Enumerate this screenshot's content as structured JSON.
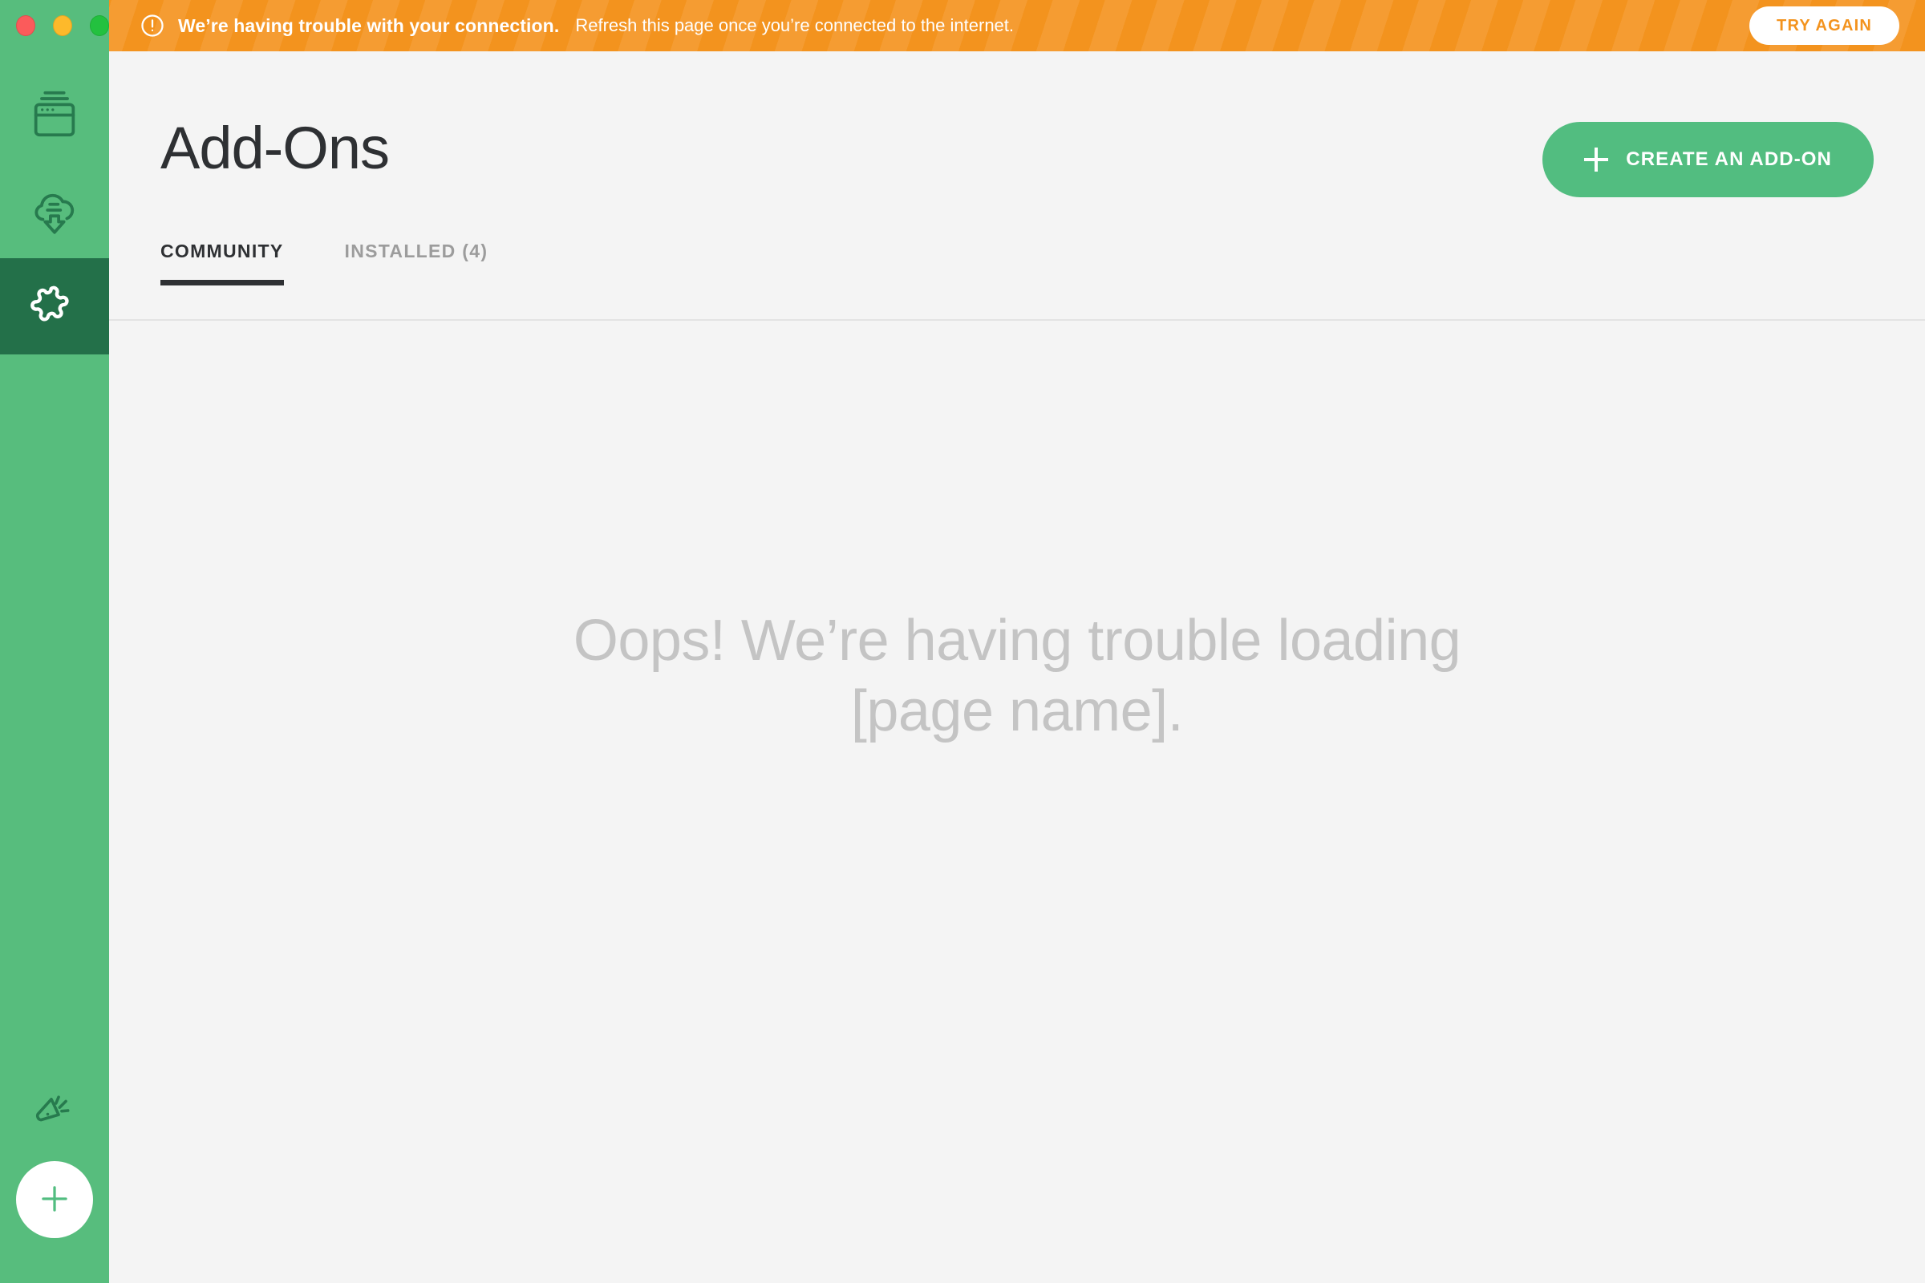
{
  "window": {
    "traffic_lights": [
      {
        "name": "close",
        "color": "#fb5b5b"
      },
      {
        "name": "minimize",
        "color": "#fdb92b"
      },
      {
        "name": "zoom",
        "color": "#23c13f"
      }
    ]
  },
  "sidebar": {
    "background": "#57bd7d",
    "active_background": "#237049",
    "items": [
      {
        "icon": "browser-windows-icon",
        "label": "Pages",
        "active": false
      },
      {
        "icon": "cloud-download-icon",
        "label": "Downloads",
        "active": false
      },
      {
        "icon": "puzzle-piece-icon",
        "label": "Add-Ons",
        "active": true
      }
    ],
    "bottom": {
      "announce": {
        "icon": "megaphone-icon",
        "label": "Announcements"
      },
      "fab": {
        "icon": "plus-icon",
        "label": "Create"
      }
    }
  },
  "banner": {
    "icon": "alert-circle-icon",
    "strong_text": "We’re having trouble with your connection.",
    "sub_text": "Refresh this page once you’re connected to the internet.",
    "button_label": "TRY AGAIN",
    "background_color": "#f3931e",
    "button_text_color": "#f3931e"
  },
  "header": {
    "title": "Add-Ons",
    "create_button": {
      "label": "CREATE AN ADD-ON",
      "icon": "plus-icon",
      "color": "#52bd80"
    },
    "tabs": [
      {
        "label": "COMMUNITY",
        "active": true
      },
      {
        "label": "INSTALLED (4)",
        "active": false
      }
    ]
  },
  "content": {
    "empty_message": "Oops! We’re having trouble loading [page name].",
    "empty_message_color": "#c4c4c4"
  }
}
